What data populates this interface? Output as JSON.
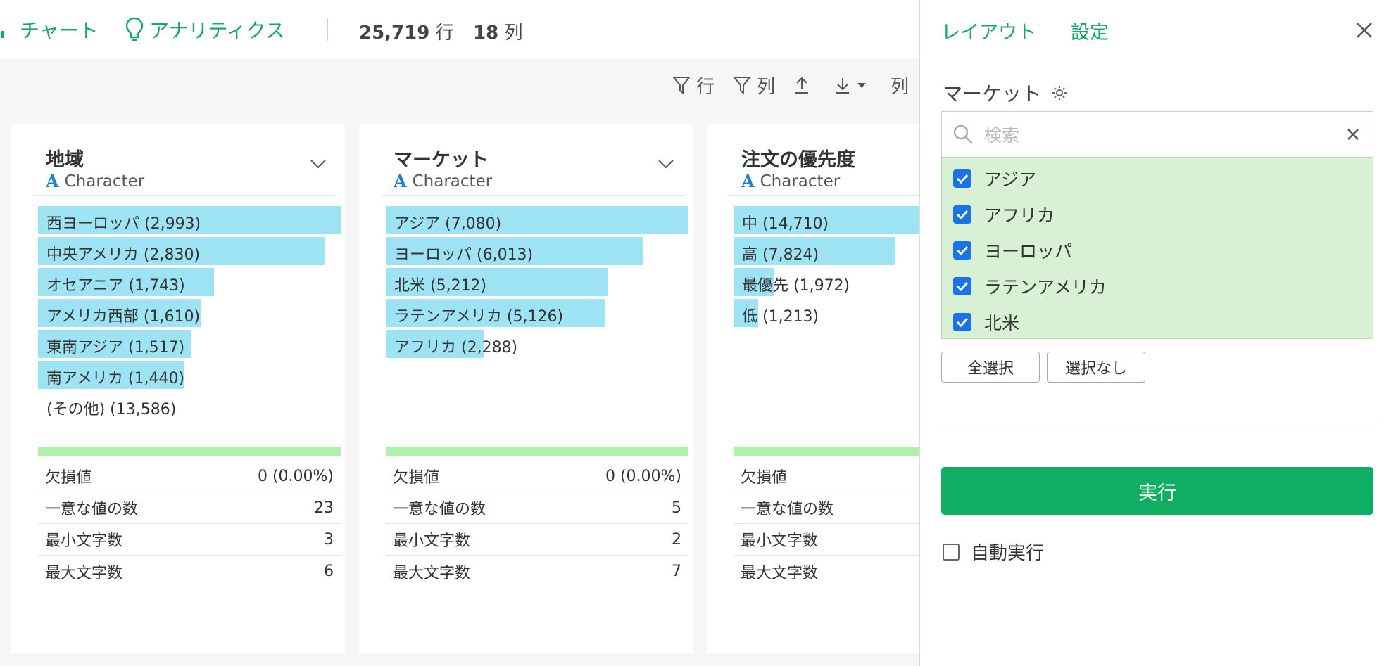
{
  "topbar": {
    "chart_label": "チャート",
    "analytics_label": "アナリティクス",
    "row_count": "25,719",
    "row_unit": "行",
    "col_count": "18",
    "col_unit": "列"
  },
  "toolbar": {
    "filter_rows": "行",
    "filter_cols": "列",
    "col_peek": "列"
  },
  "columns": [
    {
      "name": "地域",
      "type": "Character",
      "bars": [
        {
          "label": "西ヨーロッパ (2,993)",
          "fraction": 1.0
        },
        {
          "label": "中央アメリカ (2,830)",
          "fraction": 0.946
        },
        {
          "label": "オセアニア (1,743)",
          "fraction": 0.582
        },
        {
          "label": "アメリカ西部 (1,610)",
          "fraction": 0.538
        },
        {
          "label": "東南アジア (1,517)",
          "fraction": 0.507
        },
        {
          "label": "南アメリカ (1,440)",
          "fraction": 0.481
        }
      ],
      "other": "(その他) (13,586)",
      "stats": {
        "missing": "0 (0.00%)",
        "unique": "23",
        "min_len": "3",
        "max_len": "6"
      }
    },
    {
      "name": "マーケット",
      "type": "Character",
      "bars": [
        {
          "label": "アジア (7,080)",
          "fraction": 1.0
        },
        {
          "label": "ヨーロッパ (6,013)",
          "fraction": 0.849
        },
        {
          "label": "北米 (5,212)",
          "fraction": 0.736
        },
        {
          "label": "ラテンアメリカ (5,126)",
          "fraction": 0.724
        },
        {
          "label": "アフリカ (2,288)",
          "fraction": 0.323
        }
      ],
      "other": "",
      "stats": {
        "missing": "0 (0.00%)",
        "unique": "5",
        "min_len": "2",
        "max_len": "7"
      }
    },
    {
      "name": "注文の優先度",
      "type": "Character",
      "bars": [
        {
          "label": "中 (14,710)",
          "fraction": 1.0
        },
        {
          "label": "高 (7,824)",
          "fraction": 0.532
        },
        {
          "label": "最優先 (1,972)",
          "fraction": 0.134
        },
        {
          "label": "低 (1,213)",
          "fraction": 0.082
        }
      ],
      "other": "",
      "stats": {
        "missing": "",
        "unique": "",
        "min_len": "",
        "max_len": ""
      }
    }
  ],
  "stat_labels": {
    "missing": "欠損値",
    "unique": "一意な値の数",
    "min_len": "最小文字数",
    "max_len": "最大文字数"
  },
  "panel": {
    "tab_layout": "レイアウト",
    "tab_settings": "設定",
    "title": "マーケット",
    "search_placeholder": "検索",
    "options": [
      {
        "label": "アジア",
        "checked": true
      },
      {
        "label": "アフリカ",
        "checked": true
      },
      {
        "label": "ヨーロッパ",
        "checked": true
      },
      {
        "label": "ラテンアメリカ",
        "checked": true
      },
      {
        "label": "北米",
        "checked": true
      }
    ],
    "select_all": "全選択",
    "select_none": "選択なし",
    "run": "実行",
    "auto_run": "自動実行"
  },
  "colors": {
    "accent": "#14a864",
    "bar": "#9ee3f4",
    "valid": "#b3f0ad",
    "checkbox": "#1a73e8",
    "run": "#0fae62",
    "selected_bg": "#d8f1d5"
  }
}
